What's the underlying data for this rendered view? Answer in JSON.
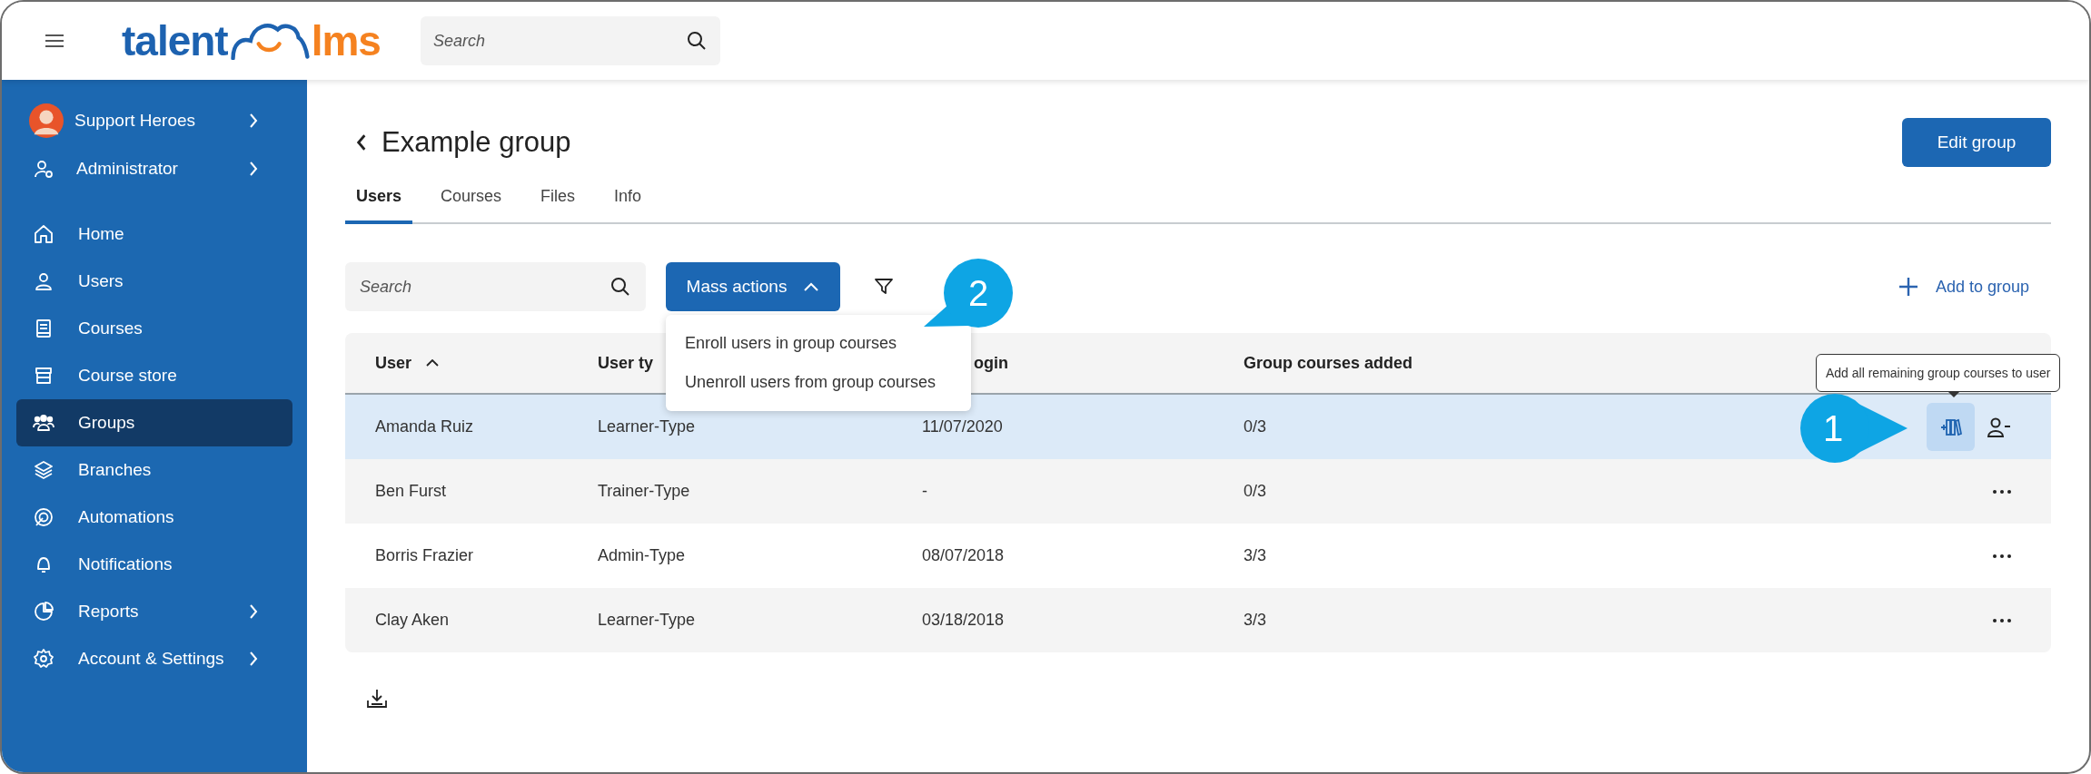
{
  "header": {
    "logo": {
      "left": "talent",
      "right": "lms"
    },
    "search": {
      "placeholder": "Search"
    }
  },
  "sidebar": {
    "profile": [
      {
        "label": "Support Heroes",
        "chevron": true
      },
      {
        "label": "Administrator",
        "chevron": true
      }
    ],
    "items": [
      {
        "label": "Home",
        "selected": false,
        "chevron": false
      },
      {
        "label": "Users",
        "selected": false,
        "chevron": false
      },
      {
        "label": "Courses",
        "selected": false,
        "chevron": false
      },
      {
        "label": "Course store",
        "selected": false,
        "chevron": false
      },
      {
        "label": "Groups",
        "selected": true,
        "chevron": false
      },
      {
        "label": "Branches",
        "selected": false,
        "chevron": false
      },
      {
        "label": "Automations",
        "selected": false,
        "chevron": false
      },
      {
        "label": "Notifications",
        "selected": false,
        "chevron": false
      },
      {
        "label": "Reports",
        "selected": false,
        "chevron": true
      },
      {
        "label": "Account & Settings",
        "selected": false,
        "chevron": true
      }
    ]
  },
  "page": {
    "title": "Example group",
    "edit_button": "Edit group"
  },
  "tabs": [
    {
      "label": "Users",
      "selected": true
    },
    {
      "label": "Courses",
      "selected": false
    },
    {
      "label": "Files",
      "selected": false
    },
    {
      "label": "Info",
      "selected": false
    }
  ],
  "toolbar": {
    "search": {
      "placeholder": "Search"
    },
    "mass_actions": {
      "label": "Mass actions",
      "expanded": true,
      "menu": [
        "Enroll users in group courses",
        "Unenroll users from group courses"
      ]
    },
    "add_button": "Add to group"
  },
  "table": {
    "columns": [
      {
        "label": "User",
        "sorted": true
      },
      {
        "label": "User ty",
        "sorted": false
      },
      {
        "label": "ogin",
        "sorted": false
      },
      {
        "label": "Group courses added",
        "sorted": false
      }
    ],
    "rows": [
      {
        "cells": [
          "Amanda Ruiz",
          "Learner-Type",
          "11/07/2020",
          "0/3"
        ],
        "selected": true
      },
      {
        "cells": [
          "Ben Furst",
          "Trainer-Type",
          "-",
          "0/3"
        ],
        "selected": false
      },
      {
        "cells": [
          "Borris Frazier",
          "Admin-Type",
          "08/07/2018",
          "3/3"
        ],
        "selected": false
      },
      {
        "cells": [
          "Clay Aken",
          "Learner-Type",
          "03/18/2018",
          "3/3"
        ],
        "selected": false
      }
    ]
  },
  "tooltip": "Add all remaining group courses to user",
  "callouts": [
    "1",
    "2"
  ]
}
